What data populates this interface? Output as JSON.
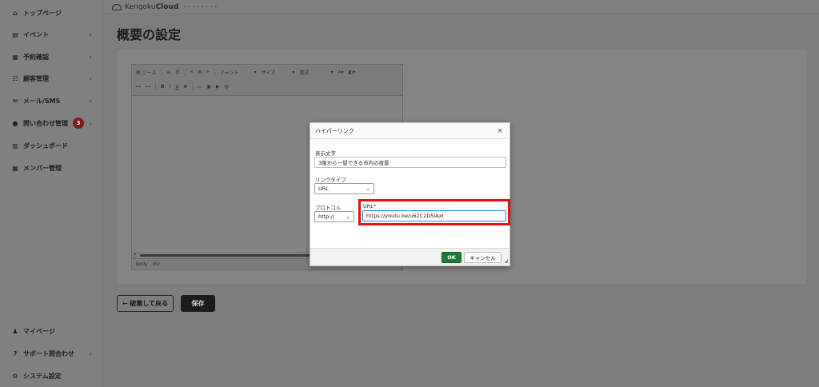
{
  "sidebar": {
    "items": [
      {
        "label": "トップページ",
        "icon": "home-icon",
        "glyph": "⌂"
      },
      {
        "label": "イベント",
        "icon": "document-icon",
        "glyph": "▤"
      },
      {
        "label": "予約確認",
        "icon": "calendar-icon",
        "glyph": "▦"
      },
      {
        "label": "顧客管理",
        "icon": "users-icon",
        "glyph": "☷"
      },
      {
        "label": "メール/SMS",
        "icon": "envelope-icon",
        "glyph": "✉"
      },
      {
        "label": "問い合わせ管理",
        "icon": "chat-icon",
        "glyph": "●",
        "badge": "3"
      },
      {
        "label": "ダッシュボード",
        "icon": "chart-icon",
        "glyph": "▥"
      },
      {
        "label": "メンバー管理",
        "icon": "grid-icon",
        "glyph": "▦"
      }
    ],
    "bottom_items": [
      {
        "label": "マイページ",
        "icon": "person-icon",
        "glyph": "♟"
      },
      {
        "label": "サポート問合わせ",
        "icon": "help-icon",
        "glyph": "?"
      },
      {
        "label": "システム設定",
        "icon": "gear-icon",
        "glyph": "⚙"
      }
    ],
    "chevron": "›"
  },
  "header": {
    "logo_main": "Kengoku",
    "logo_strong": "Cloud",
    "logo_sub": "• • • • • • • •"
  },
  "page": {
    "title": "概要の設定"
  },
  "editor": {
    "source_label": "ソース",
    "font_label": "フォント",
    "size_label": "サイズ",
    "format_label": "書式",
    "bold": "B",
    "italic": "I",
    "underline": "U",
    "strike": "S",
    "path": [
      "body",
      "div"
    ]
  },
  "actions": {
    "back_label": "← 破棄して戻る",
    "save_label": "保存"
  },
  "dialog": {
    "title": "ハイパーリンク",
    "close": "×",
    "display_text_label": "表示文字",
    "display_text_value": "3階から一望できる市内の夜景",
    "link_type_label": "リンクタイプ",
    "link_type_value": "URL",
    "protocol_label": "プロトコル",
    "protocol_value": "http://",
    "url_label": "URL*",
    "url_value": "https://youtu.be/u62C2D5iAxI",
    "ok_label": "OK",
    "cancel_label": "キャンセル"
  },
  "colors": {
    "ok_green": "#1f7a34",
    "highlight_red": "#e01515",
    "url_border_blue": "#2f86d8",
    "badge": "#7a1d1d"
  }
}
